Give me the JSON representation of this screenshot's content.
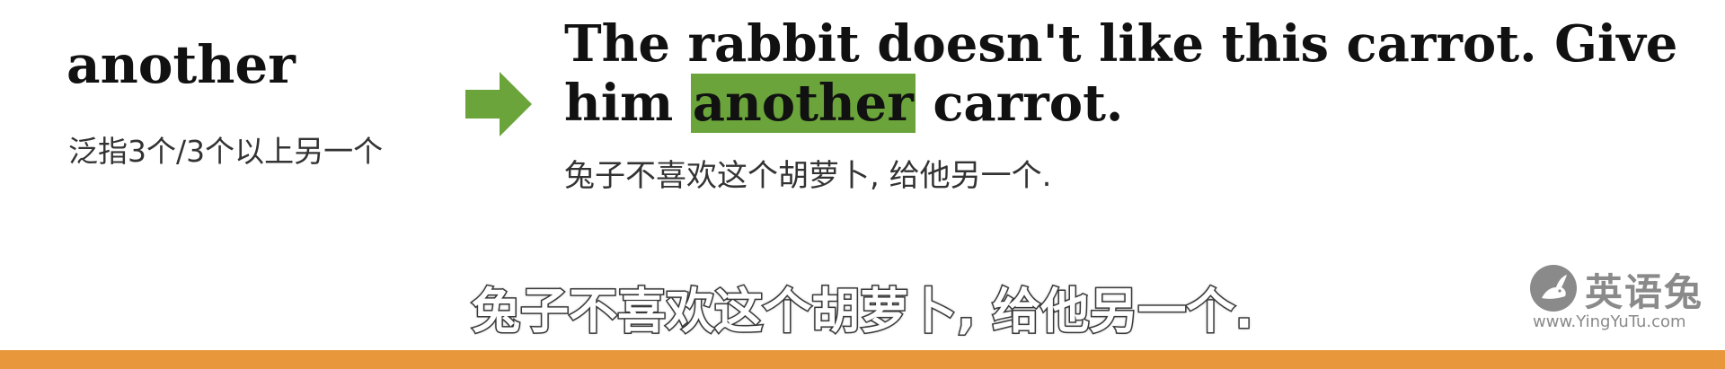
{
  "word": {
    "term": "another",
    "meaning": "泛指3个/3个以上另一个"
  },
  "sentence": {
    "part1": "The rabbit doesn't like this carrot. Give him ",
    "highlight": "another",
    "part2": " carrot.",
    "translation": "兔子不喜欢这个胡萝卜, 给他另一个."
  },
  "subtitle": "兔子不喜欢这个胡萝卜, 给他另一个.",
  "logo": {
    "name": "英语兔",
    "url": "www.YingYuTu.com"
  },
  "colors": {
    "highlight": "#6aa43a",
    "arrow": "#6aa43a",
    "bottom_bar": "#e8973a",
    "logo_gray": "#8a8a8a"
  },
  "icons": {
    "arrow": "right-arrow-icon",
    "logo": "rabbit-logo-icon"
  }
}
